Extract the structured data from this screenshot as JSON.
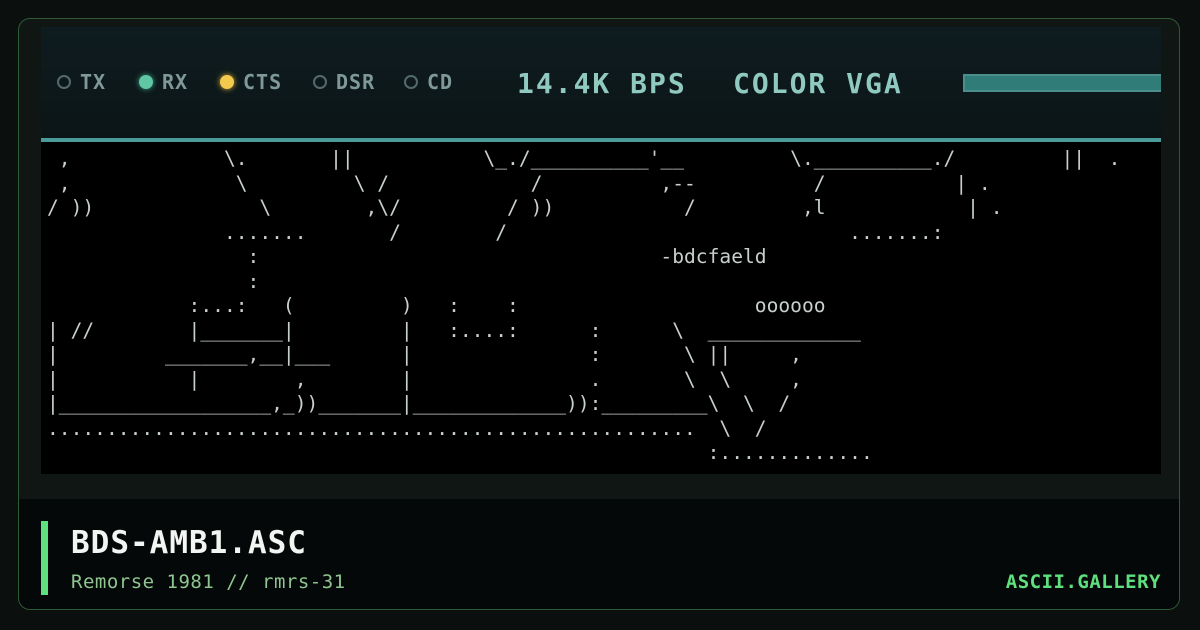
{
  "indicators": [
    {
      "label": "TX",
      "state": "off"
    },
    {
      "label": "RX",
      "state": "on",
      "color": "#5fc7a4"
    },
    {
      "label": "CTS",
      "state": "on",
      "color": "#f3c94e"
    },
    {
      "label": "DSR",
      "state": "off"
    },
    {
      "label": "CD",
      "state": "off"
    }
  ],
  "status": {
    "speed": "14.4K BPS",
    "display_mode": "COLOR VGA"
  },
  "meter_level": 1.0,
  "art": {
    "text": " ,             \\.       ||           \\_./__________'__         \\.__________./         ||  .\n ,              \\         \\ /            /          ,--          /           | .\n/ ))              \\        ,\\/         / ))           /         ,l            | .\n               .......       /        /                             .......:\n                 :                                  -bdcfaeld\n                 :\n            :...:   (         )   :    :                    oooooo\n| //        |_______|         |   :....:      :      \\  _____________\n|         _______,__|___      |               :       \\ ||     ,\n|           |        ,        |               .       \\  \\     ,\n|__________________,_))_______|_____________)):_________\\  \\  /\n.......................................................  \\  /\n                                                        :.............\n"
  },
  "footer": {
    "title": "BDS-AMB1.ASC",
    "subtitle": "Remorse 1981 // rmrs-31",
    "brand": "ASCII.GALLERY"
  },
  "colors": {
    "accent": "#5fe07e",
    "status_text": "#8fc9c0",
    "screen_bg": "#000000"
  }
}
